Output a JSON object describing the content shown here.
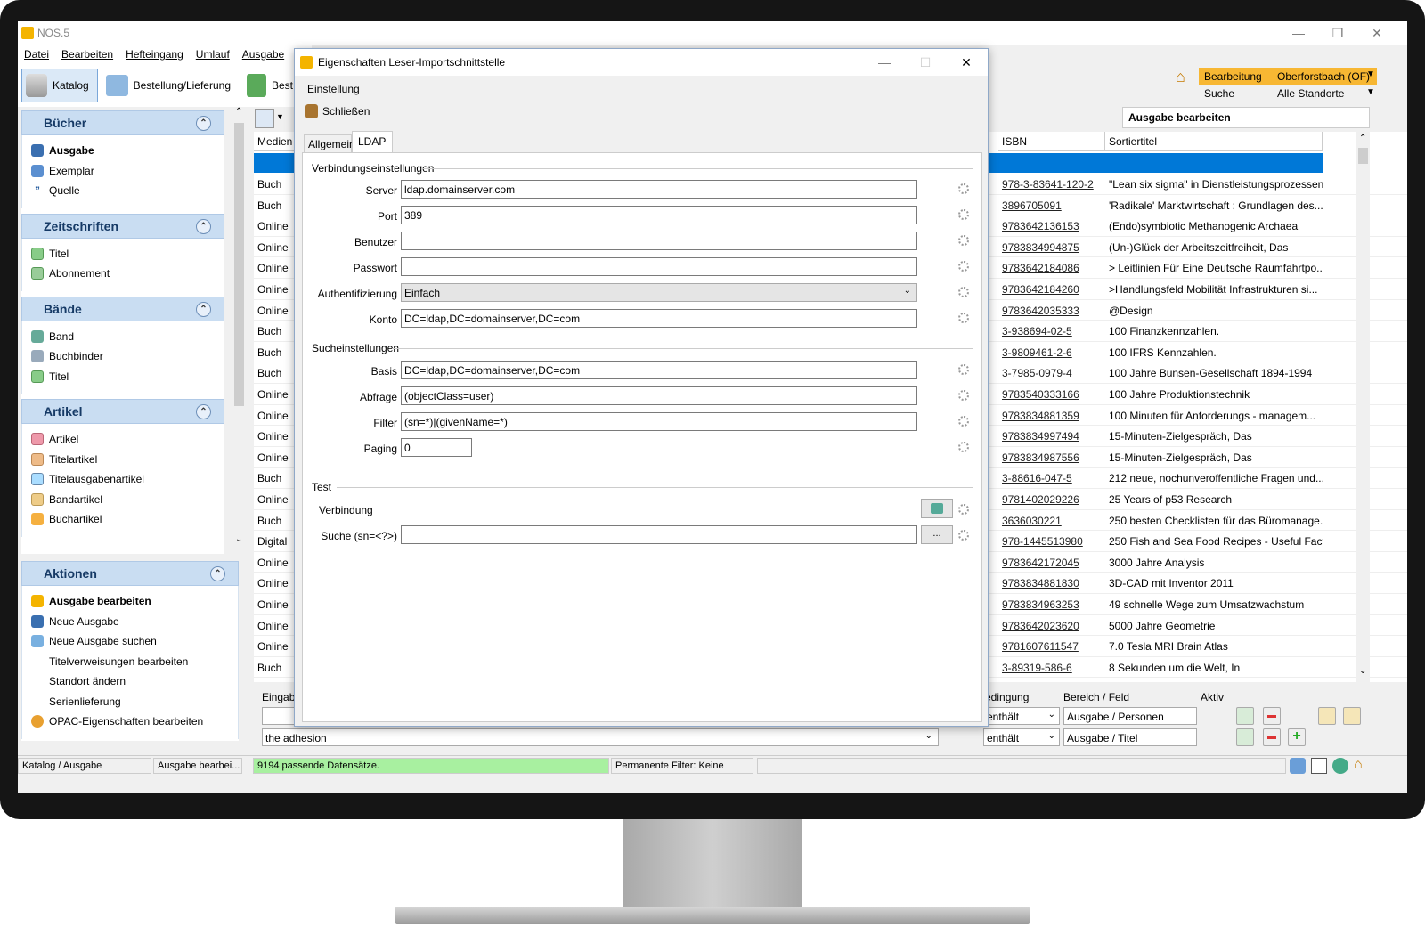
{
  "app": {
    "title": "NOS.5"
  },
  "menu": [
    "Datei",
    "Bearbeiten",
    "Hefteingang",
    "Umlauf",
    "Ausgabe"
  ],
  "toolbar": {
    "katalog": "Katalog",
    "bestellung": "Bestellung/Lieferung",
    "best": "Best"
  },
  "right_toolbar": {
    "bearbeitung": "Bearbeitung",
    "location": "Oberforstbach (OF)",
    "suche": "Suche",
    "standorte": "Alle Standorte",
    "edit_title": "Ausgabe bearbeiten"
  },
  "sidebar": {
    "buecher": {
      "title": "Bücher",
      "items": [
        "Ausgabe",
        "Exemplar",
        "Quelle"
      ]
    },
    "zeitschriften": {
      "title": "Zeitschriften",
      "items": [
        "Titel",
        "Abonnement"
      ]
    },
    "baende": {
      "title": "Bände",
      "items": [
        "Band",
        "Buchbinder",
        "Titel"
      ]
    },
    "artikel": {
      "title": "Artikel",
      "items": [
        "Artikel",
        "Titelartikel",
        "Titelausgabenartikel",
        "Bandartikel",
        "Buchartikel"
      ]
    }
  },
  "aktionen": {
    "title": "Aktionen",
    "items": [
      "Ausgabe bearbeiten",
      "Neue Ausgabe",
      "Neue Ausgabe suchen",
      "Titelverweisungen bearbeiten",
      "Standort ändern",
      "Serienlieferung",
      "OPAC-Eigenschaften bearbeiten"
    ]
  },
  "grid": {
    "headers": {
      "medium": "Medien",
      "isbn": "ISBN",
      "sortiertitel": "Sortiertitel"
    },
    "rows": [
      {
        "m": "Buch",
        "isbn": "978-3-83641-120-2",
        "t": "\"Lean six sigma\" in Dienstleistungsprozessen"
      },
      {
        "m": "Buch",
        "isbn": "3896705091",
        "t": "'Radikale' Marktwirtschaft : Grundlagen des..."
      },
      {
        "m": "Online",
        "isbn": "9783642136153",
        "t": "(Endo)symbiotic Methanogenic Archaea"
      },
      {
        "m": "Online",
        "isbn": "9783834994875",
        "t": "(Un-)Glück der Arbeitszeitfreiheit, Das"
      },
      {
        "m": "Online",
        "isbn": "9783642184086",
        "t": "> Leitlinien Für Eine Deutsche Raumfahrtpo..."
      },
      {
        "m": "Online",
        "isbn": "9783642184260",
        "t": ">Handlungsfeld Mobilität Infrastrukturen si..."
      },
      {
        "m": "Online",
        "isbn": "9783642035333",
        "t": "@Design"
      },
      {
        "m": "Buch",
        "isbn": "3-938694-02-5",
        "t": "100 Finanzkennzahlen."
      },
      {
        "m": "Buch",
        "isbn": "3-9809461-2-6",
        "t": "100 IFRS Kennzahlen."
      },
      {
        "m": "Buch",
        "isbn": "3-7985-0979-4",
        "t": "100 Jahre Bunsen-Gesellschaft 1894-1994"
      },
      {
        "m": "Online",
        "isbn": "9783540333166",
        "t": "100 Jahre Produktionstechnik"
      },
      {
        "m": "Online",
        "isbn": "9783834881359",
        "t": "100 Minuten für Anforderungs - managem..."
      },
      {
        "m": "Online",
        "isbn": "9783834997494",
        "t": "15-Minuten-Zielgespräch, Das"
      },
      {
        "m": "Online",
        "isbn": "9783834987556",
        "t": "15-Minuten-Zielgespräch, Das"
      },
      {
        "m": "Buch",
        "isbn": "3-88616-047-5",
        "t": "212 neue, nochunveroffentliche Fragen und..."
      },
      {
        "m": "Online",
        "isbn": "9781402029226",
        "t": "25 Years of p53 Research"
      },
      {
        "m": "Buch",
        "isbn": "3636030221",
        "t": "250 besten Checklisten für das Büromanage..."
      },
      {
        "m": "Digital",
        "isbn": "978-1445513980",
        "t": "250 Fish and Sea Food Recipes - Useful Fact..."
      },
      {
        "m": "Online",
        "isbn": "9783642172045",
        "t": "3000 Jahre Analysis"
      },
      {
        "m": "Online",
        "isbn": "9783834881830",
        "t": "3D-CAD mit Inventor 2011"
      },
      {
        "m": "Online",
        "isbn": "9783834963253",
        "t": "49 schnelle Wege zum Umsatzwachstum"
      },
      {
        "m": "Online",
        "isbn": "9783642023620",
        "t": "5000 Jahre Geometrie"
      },
      {
        "m": "Online",
        "isbn": "9781607611547",
        "t": "7.0 Tesla MRI Brain Atlas"
      },
      {
        "m": "Buch",
        "isbn": "3-89319-586-6",
        "t": "8 Sekunden um die Welt, In"
      }
    ]
  },
  "filter": {
    "eingabe": "Eingab",
    "search_value": "the adhesion",
    "bedingung": "edingung",
    "bereich": "Bereich / Feld",
    "aktiv": "Aktiv",
    "rows": [
      {
        "cond": "enthält",
        "field": "Ausgabe / Personen"
      },
      {
        "cond": "enthält",
        "field": "Ausgabe / Titel"
      }
    ]
  },
  "status": {
    "left": "Katalog / Ausgabe",
    "mid": "Ausgabe bearbei...",
    "count": "9194 passende Datensätze.",
    "filter": "Permanente Filter: Keine"
  },
  "dialog": {
    "title": "Eigenschaften Leser-Importschnittstelle",
    "einstellung": "Einstellung",
    "schliessen": "Schließen",
    "tabs": [
      "Allgemein",
      "LDAP"
    ],
    "sec_verbindung": "Verbindungseinstellungen",
    "sec_suche": "Sucheinstellungen",
    "sec_test": "Test",
    "labels": {
      "server": "Server",
      "port": "Port",
      "benutzer": "Benutzer",
      "passwort": "Passwort",
      "auth": "Authentifizierung",
      "konto": "Konto",
      "basis": "Basis",
      "abfrage": "Abfrage",
      "filter": "Filter",
      "paging": "Paging",
      "verbindung": "Verbindung",
      "suche": "Suche (sn=<?>)"
    },
    "values": {
      "server": "ldap.domainserver.com",
      "port": "389",
      "benutzer": "",
      "passwort": "",
      "auth": "Einfach",
      "konto": "DC=ldap,DC=domainserver,DC=com",
      "basis": "DC=ldap,DC=domainserver,DC=com",
      "abfrage": "(objectClass=user)",
      "filter": "(sn=*)|(givenName=*)",
      "paging": "0",
      "suche": ""
    },
    "dots": "..."
  },
  "colors": {
    "accent": "#0078d7",
    "header_blue": "#c9ddf2",
    "status_green": "#a8f0a0",
    "orange": "#f4b400"
  }
}
